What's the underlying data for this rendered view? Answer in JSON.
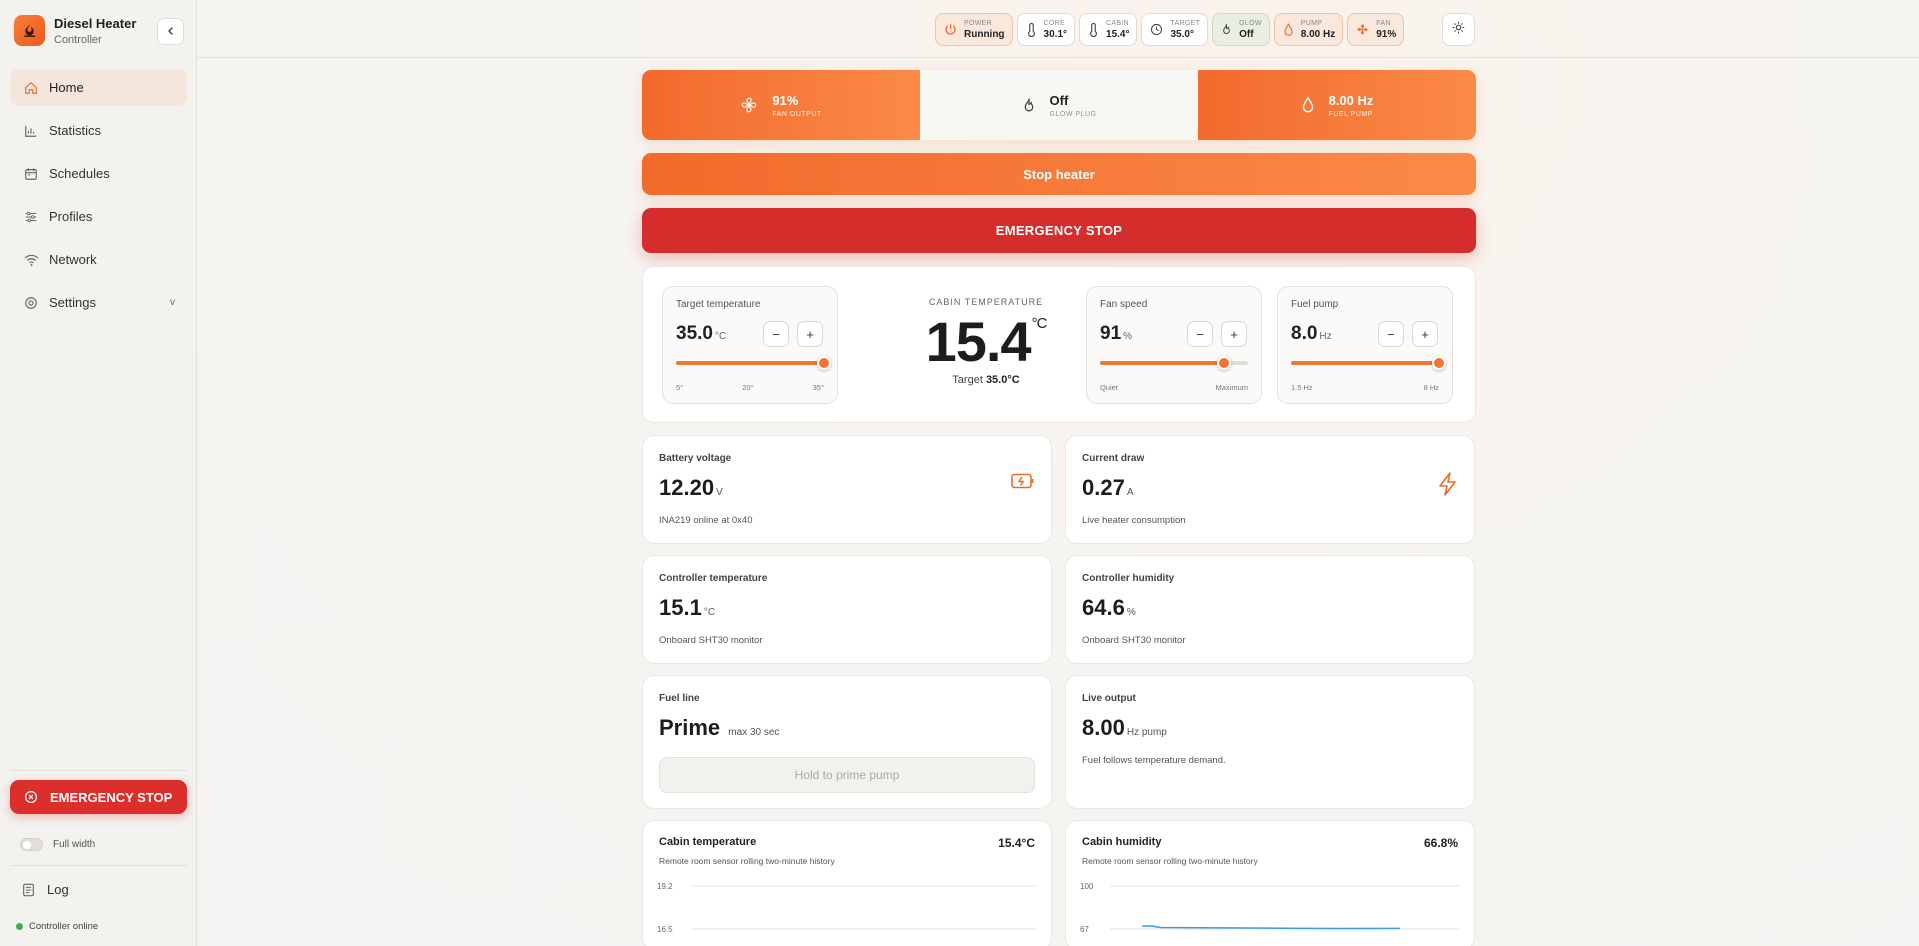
{
  "app": {
    "title": "Diesel Heater",
    "subtitle": "Controller"
  },
  "sidebar": {
    "items": [
      {
        "label": "Home",
        "icon": "home-icon",
        "active": true
      },
      {
        "label": "Statistics",
        "icon": "bar-chart-icon"
      },
      {
        "label": "Schedules",
        "icon": "calendar-icon"
      },
      {
        "label": "Profiles",
        "icon": "sliders-icon"
      },
      {
        "label": "Network",
        "icon": "wifi-icon"
      },
      {
        "label": "Settings",
        "icon": "gear-icon",
        "chevron": "v"
      }
    ],
    "emergency_label": "EMERGENCY STOP",
    "full_width_label": "Full width",
    "log_label": "Log",
    "status_label": "Controller online"
  },
  "topbar": {
    "chips": [
      {
        "label": "POWER",
        "value": "Running",
        "icon": "power-icon",
        "style": "orange"
      },
      {
        "label": "CORE",
        "value": "30.1°",
        "icon": "thermometer-icon",
        "style": "plain"
      },
      {
        "label": "CABIN",
        "value": "15.4°",
        "icon": "thermometer-icon",
        "style": "plain"
      },
      {
        "label": "TARGET",
        "value": "35.0°",
        "icon": "clock-icon",
        "style": "plain"
      },
      {
        "label": "GLOW",
        "value": "Off",
        "icon": "flame-icon",
        "style": "green"
      },
      {
        "label": "PUMP",
        "value": "8.00 Hz",
        "icon": "droplet-icon",
        "style": "orange"
      },
      {
        "label": "FAN",
        "value": "91%",
        "icon": "fan-icon",
        "style": "orange"
      }
    ],
    "theme_icon": "sun-icon"
  },
  "status_strip": [
    {
      "value": "91%",
      "label": "FAN OUTPUT",
      "icon": "fan-icon"
    },
    {
      "value": "Off",
      "label": "GLOW PLUG",
      "icon": "flame-icon"
    },
    {
      "value": "8.00 Hz",
      "label": "FUEL PUMP",
      "icon": "droplet-icon"
    }
  ],
  "actions": {
    "stop_label": "Stop heater",
    "emergency_label": "EMERGENCY STOP"
  },
  "controls": {
    "target": {
      "title": "Target temperature",
      "value": "35.0",
      "unit": "°C",
      "ticks": [
        "5°",
        "20°",
        "35°"
      ],
      "min": 5,
      "max": 35,
      "current": 35
    },
    "cabin": {
      "label": "CABIN TEMPERATURE",
      "value": "15.4",
      "unit": "°C",
      "target_prefix": "Target",
      "target_value": "35.0°C"
    },
    "fan": {
      "title": "Fan speed",
      "value": "91",
      "unit": "%",
      "ticks": [
        "Quiet",
        "Maximum"
      ],
      "level_percent": 84
    },
    "pump": {
      "title": "Fuel pump",
      "value": "8.0",
      "unit": "Hz",
      "ticks": [
        "1.5 Hz",
        "8 Hz"
      ],
      "min": 1.5,
      "max": 8,
      "current": 8
    }
  },
  "cards": {
    "battery": {
      "title": "Battery voltage",
      "value": "12.20",
      "unit": "V",
      "sub": "INA219 online at 0x40",
      "icon": "battery-charging-icon"
    },
    "current": {
      "title": "Current draw",
      "value": "0.27",
      "unit": "A",
      "sub": "Live heater consumption",
      "icon": "lightning-icon"
    },
    "ctrl_temp": {
      "title": "Controller temperature",
      "value": "15.1",
      "unit": "°C",
      "sub": "Onboard SHT30 monitor"
    },
    "ctrl_hum": {
      "title": "Controller humidity",
      "value": "64.6",
      "unit": "%",
      "sub": "Onboard SHT30 monitor"
    },
    "fuel_line": {
      "title": "Fuel line",
      "value": "Prime",
      "unit": "max 30 sec",
      "button": "Hold to prime pump"
    },
    "live_output": {
      "title": "Live output",
      "value": "8.00",
      "unit": "Hz pump",
      "sub": "Fuel follows temperature demand."
    }
  },
  "charts": {
    "cabin_temp": {
      "title": "Cabin temperature",
      "value": "15.4°C",
      "sub": "Remote room sensor rolling two-minute history",
      "ticks": [
        "19.2",
        "16.5"
      ]
    },
    "cabin_hum": {
      "title": "Cabin humidity",
      "value": "66.8%",
      "sub": "Remote room sensor rolling two-minute history",
      "ticks": [
        "100",
        "67"
      ],
      "line_color": "#3d9be0"
    }
  }
}
